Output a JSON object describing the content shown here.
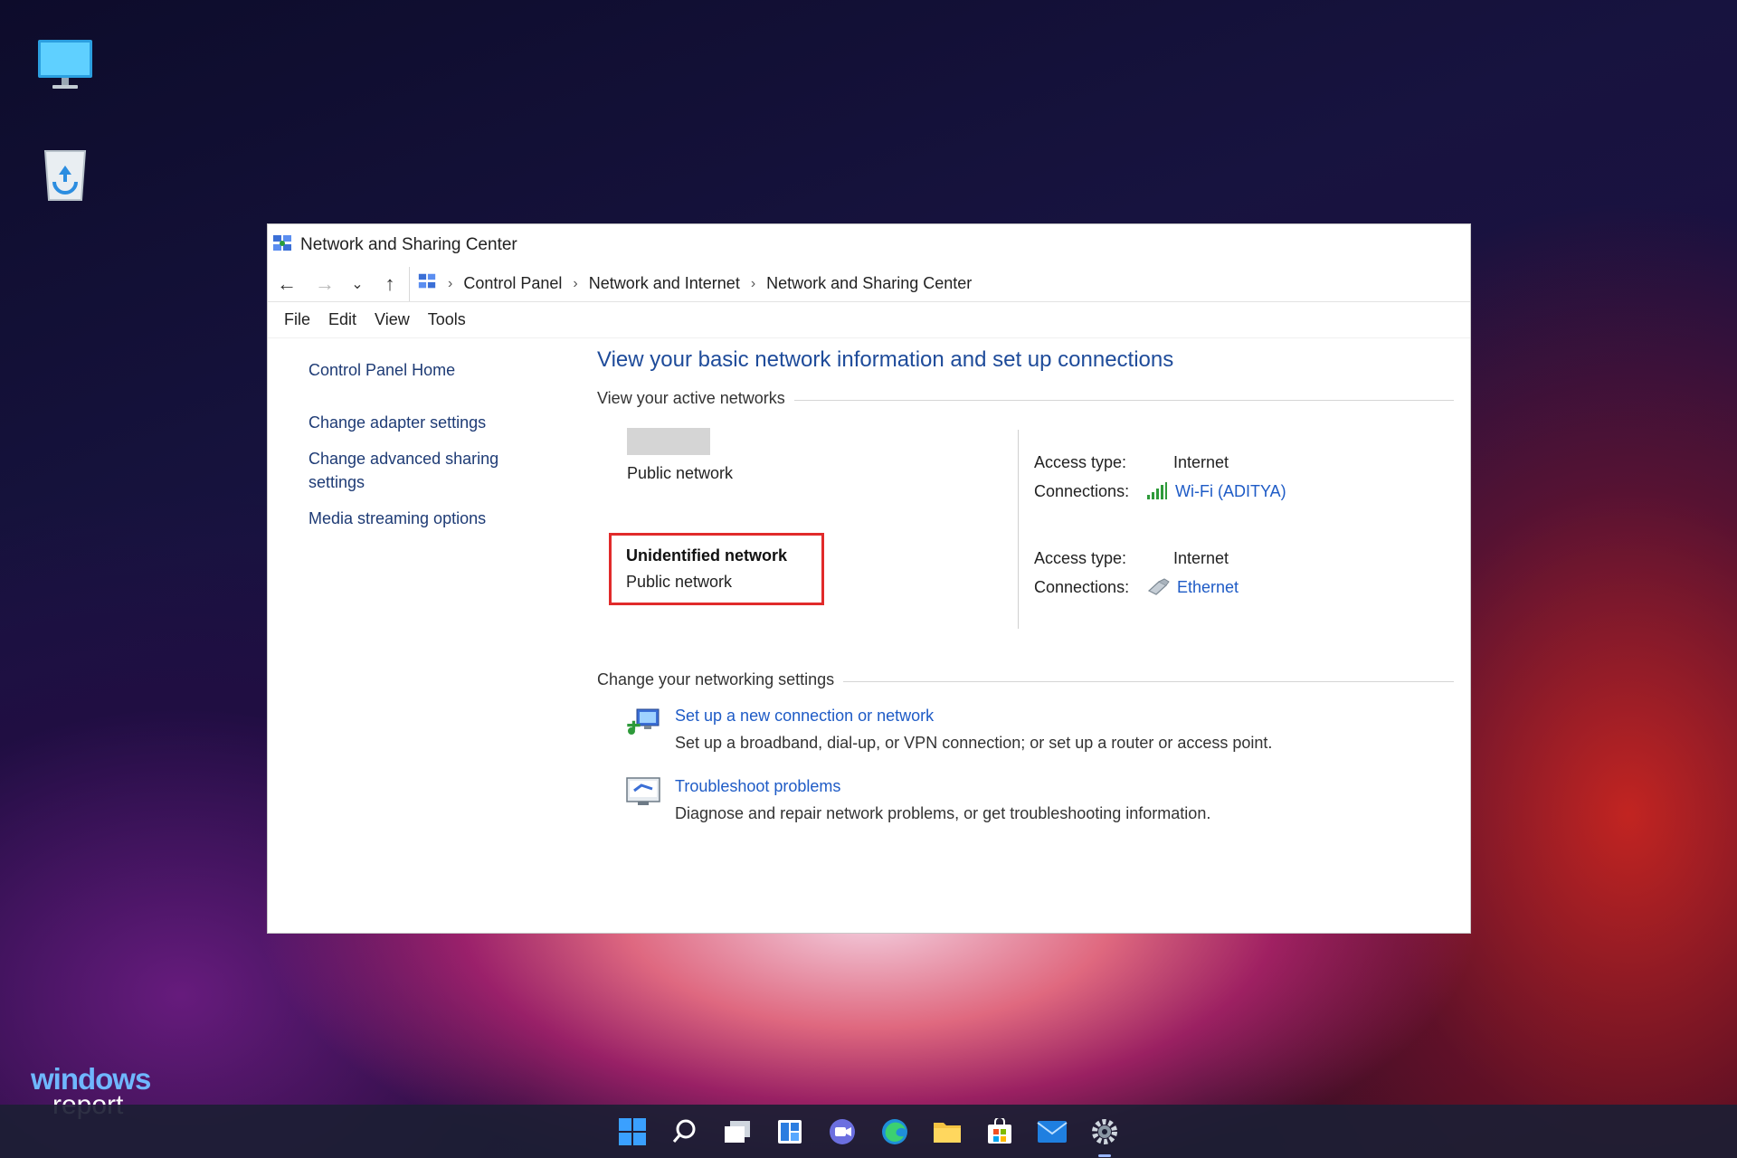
{
  "window": {
    "title": "Network and Sharing Center",
    "breadcrumb": [
      "Control Panel",
      "Network and Internet",
      "Network and Sharing Center"
    ],
    "menu": [
      "File",
      "Edit",
      "View",
      "Tools"
    ]
  },
  "left_pane": {
    "home": "Control Panel Home",
    "links": [
      "Change adapter settings",
      "Change advanced sharing settings",
      "Media streaming options"
    ]
  },
  "main": {
    "heading": "View your basic network information and set up connections",
    "active_networks_label": "View your active networks",
    "networks": [
      {
        "name": "",
        "type": "Public network",
        "access_type_label": "Access type:",
        "access_type": "Internet",
        "connections_label": "Connections:",
        "connection": "Wi-Fi (ADITYA)",
        "connection_icon": "wifi-signal-icon"
      },
      {
        "name": "Unidentified network",
        "type": "Public network",
        "access_type_label": "Access type:",
        "access_type": "Internet",
        "connections_label": "Connections:",
        "connection": "Ethernet",
        "connection_icon": "ethernet-icon"
      }
    ],
    "settings_label": "Change your networking settings",
    "tasks": [
      {
        "link": "Set up a new connection or network",
        "desc": "Set up a broadband, dial-up, or VPN connection; or set up a router or access point.",
        "icon": "new-connection-icon"
      },
      {
        "link": "Troubleshoot problems",
        "desc": "Diagnose and repair network problems, or get troubleshooting information.",
        "icon": "troubleshoot-icon"
      }
    ]
  },
  "brand": {
    "line1": "windows",
    "line2": "report"
  },
  "colors": {
    "link": "#1e5bc6",
    "heading": "#1e4b9a",
    "highlight": "#e12a2a",
    "taskbar": "#1c1e34"
  },
  "taskbar_icons": [
    "start-icon",
    "search-icon",
    "task-view-icon",
    "widgets-icon",
    "chat-icon",
    "edge-icon",
    "file-explorer-icon",
    "store-icon",
    "mail-icon",
    "settings-icon"
  ]
}
